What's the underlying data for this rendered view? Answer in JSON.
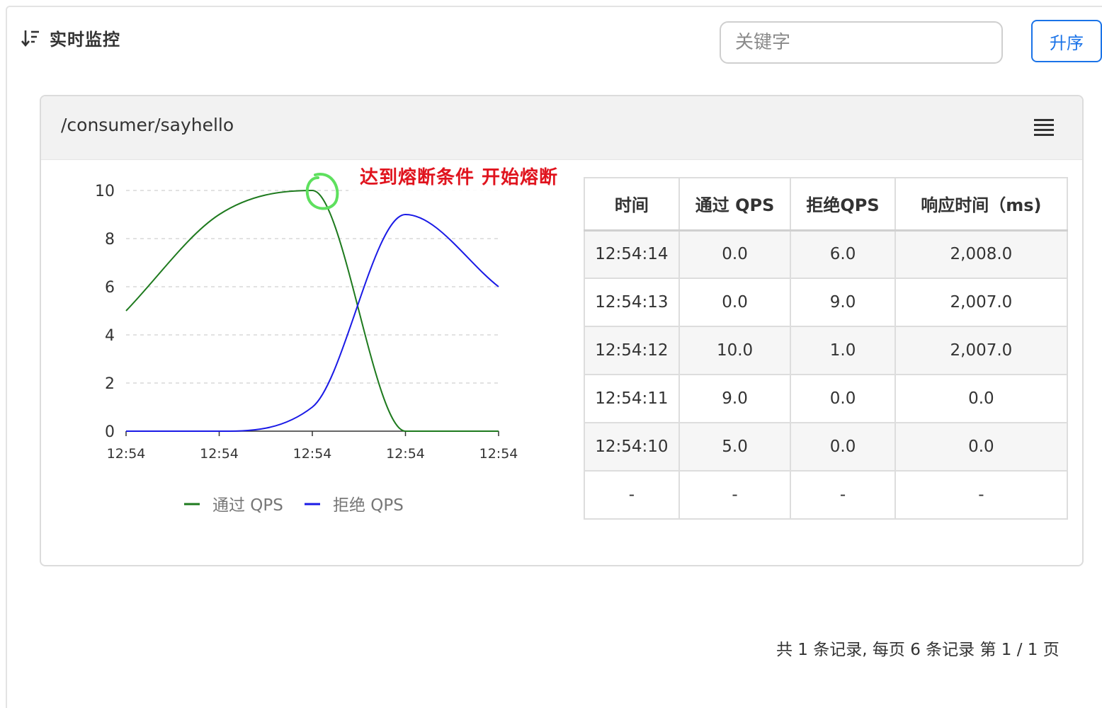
{
  "header": {
    "title": "实时监控",
    "search_placeholder": "关键字",
    "sort_label": "升序"
  },
  "panel": {
    "resource": "/consumer/sayhello",
    "annotation": "达到熔断条件 开始熔断"
  },
  "colors": {
    "pass": "#1e7a1e",
    "block": "#1a1ae6",
    "annotation": "#e0141e",
    "highlight_circle": "#5ee05e",
    "accent": "#1a73e8"
  },
  "chart_data": {
    "type": "line",
    "x": [
      "12:54",
      "12:54",
      "12:54",
      "12:54",
      "12:54"
    ],
    "ylim": [
      0,
      10
    ],
    "yticks": [
      0,
      2,
      4,
      6,
      8,
      10
    ],
    "grid": true,
    "legend_position": "bottom",
    "series": [
      {
        "name": "通过 QPS",
        "values": [
          5,
          9,
          10,
          0,
          0
        ]
      },
      {
        "name": "拒绝 QPS",
        "values": [
          0,
          0,
          1,
          9,
          6
        ]
      }
    ]
  },
  "table": {
    "columns": [
      "时间",
      "通过 QPS",
      "拒绝QPS",
      "响应时间（ms)"
    ],
    "rows": [
      [
        "12:54:14",
        "0.0",
        "6.0",
        "2,008.0"
      ],
      [
        "12:54:13",
        "0.0",
        "9.0",
        "2,007.0"
      ],
      [
        "12:54:12",
        "10.0",
        "1.0",
        "2,007.0"
      ],
      [
        "12:54:11",
        "9.0",
        "0.0",
        "0.0"
      ],
      [
        "12:54:10",
        "5.0",
        "0.0",
        "0.0"
      ],
      [
        "-",
        "-",
        "-",
        "-"
      ]
    ]
  },
  "pagination": "共 1 条记录, 每页 6 条记录 第 1 / 1 页"
}
